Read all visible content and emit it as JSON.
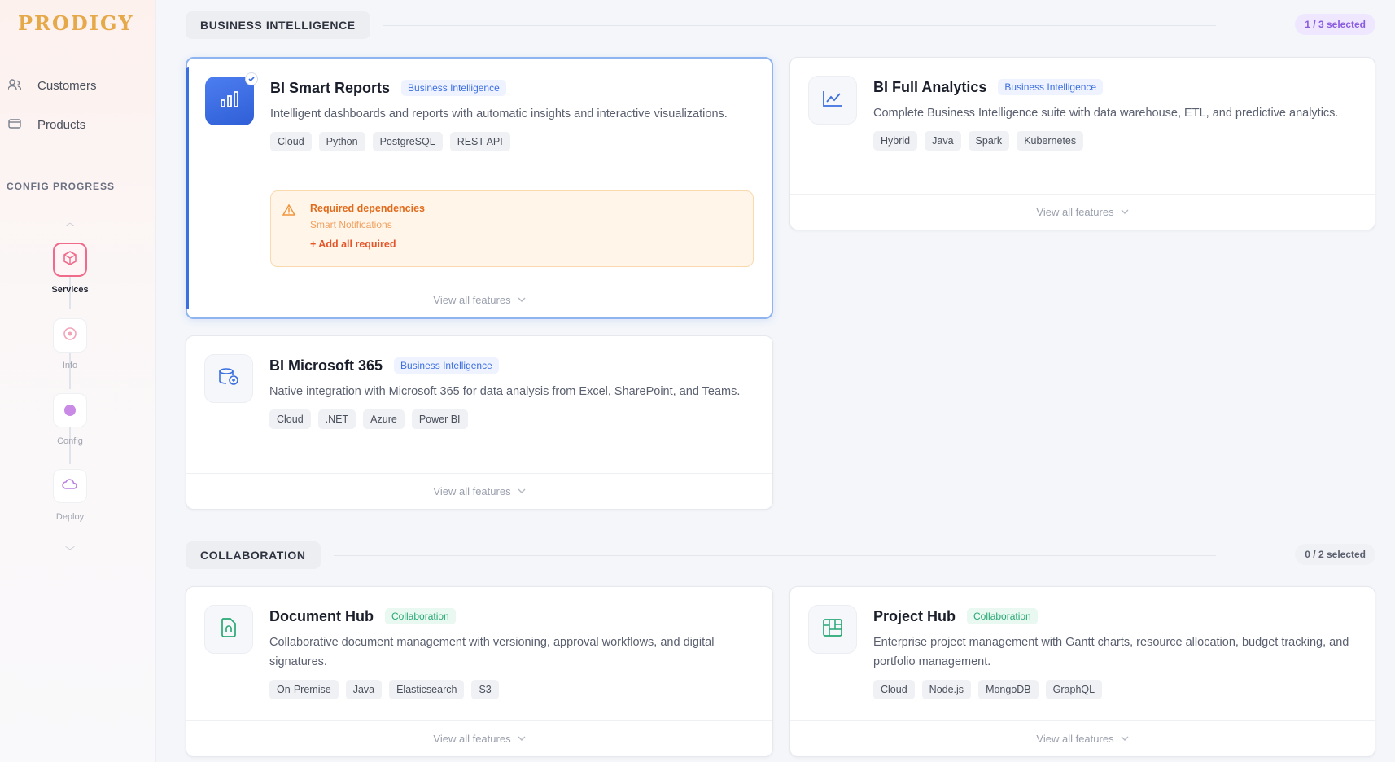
{
  "app": {
    "logo": "PRODIGY"
  },
  "sidebar": {
    "nav": [
      {
        "label": "Customers",
        "icon": "users-icon"
      },
      {
        "label": "Products",
        "icon": "box-icon"
      }
    ],
    "progress_label": "CONFIG PROGRESS",
    "steps": [
      {
        "label": "Services",
        "active": true
      },
      {
        "label": "Info",
        "active": false
      },
      {
        "label": "Config",
        "active": false
      },
      {
        "label": "Deploy",
        "active": false
      }
    ]
  },
  "sections": [
    {
      "title": "BUSINESS INTELLIGENCE",
      "selected": "1 / 3 selected",
      "cards": [
        {
          "title": "BI Smart Reports",
          "category": "Business Intelligence",
          "description": "Intelligent dashboards and reports with automatic insights and interactive visualizations.",
          "tags": [
            "Cloud",
            "Python",
            "PostgreSQL",
            "REST API"
          ],
          "selected": true,
          "icon": "bar-chart-icon",
          "dependencies": {
            "title": "Required dependencies",
            "items": "Smart Notifications",
            "action": "+ Add all required"
          },
          "footer": "View all features"
        },
        {
          "title": "BI Full Analytics",
          "category": "Business Intelligence",
          "description": "Complete Business Intelligence suite with data warehouse, ETL, and predictive analytics.",
          "tags": [
            "Hybrid",
            "Java",
            "Spark",
            "Kubernetes"
          ],
          "selected": false,
          "icon": "line-chart-icon",
          "footer": "View all features"
        },
        {
          "title": "BI Microsoft 365",
          "category": "Business Intelligence",
          "description": "Native integration with Microsoft 365 for data analysis from Excel, SharePoint, and Teams.",
          "tags": [
            "Cloud",
            ".NET",
            "Azure",
            "Power BI"
          ],
          "selected": false,
          "icon": "database-link-icon",
          "footer": "View all features"
        }
      ]
    },
    {
      "title": "COLLABORATION",
      "selected": "0 / 2 selected",
      "cards": [
        {
          "title": "Document Hub",
          "category": "Collaboration",
          "description": "Collaborative document management with versioning, approval workflows, and digital signatures.",
          "tags": [
            "On-Premise",
            "Java",
            "Elasticsearch",
            "S3"
          ],
          "selected": false,
          "icon": "document-icon",
          "footer": "View all features"
        },
        {
          "title": "Project Hub",
          "category": "Collaboration",
          "description": "Enterprise project management with Gantt charts, resource allocation, budget tracking, and portfolio management.",
          "tags": [
            "Cloud",
            "Node.js",
            "MongoDB",
            "GraphQL"
          ],
          "selected": false,
          "icon": "kanban-icon",
          "footer": "View all features"
        }
      ]
    }
  ],
  "colors": {
    "accent_blue": "#3b6fe0",
    "collab_green": "#27a874",
    "active_step": "#f06a8a",
    "warning_orange": "#e06b1c"
  }
}
